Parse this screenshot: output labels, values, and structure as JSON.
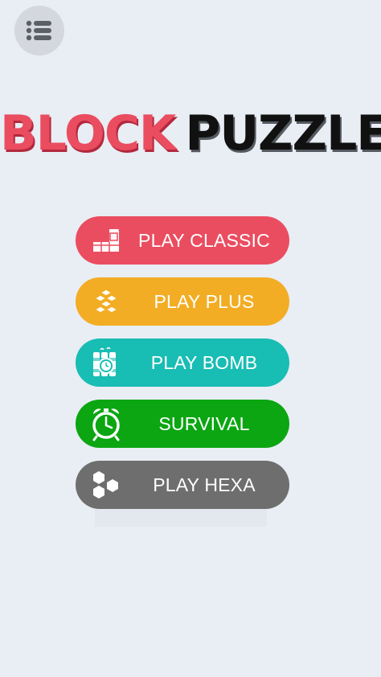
{
  "header": {
    "menu_icon": "list-icon"
  },
  "title": {
    "word1": "BLOCK",
    "word2": "PUZZLE",
    "color1": "#ea4d60",
    "color2": "#111111"
  },
  "modes": [
    {
      "label": "PLAY CLASSIC",
      "color": "#ea4d60",
      "icon": "tetromino-block-icon"
    },
    {
      "label": "PLAY PLUS",
      "color": "#f2ad24",
      "icon": "plus-blocks-icon"
    },
    {
      "label": "PLAY BOMB",
      "color": "#18bdb3",
      "icon": "dynamite-timer-icon"
    },
    {
      "label": "SURVIVAL",
      "color": "#0ba612",
      "icon": "alarm-clock-icon"
    },
    {
      "label": "PLAY HEXA",
      "color": "#6e6e6e",
      "icon": "hexagon-cluster-icon"
    }
  ]
}
